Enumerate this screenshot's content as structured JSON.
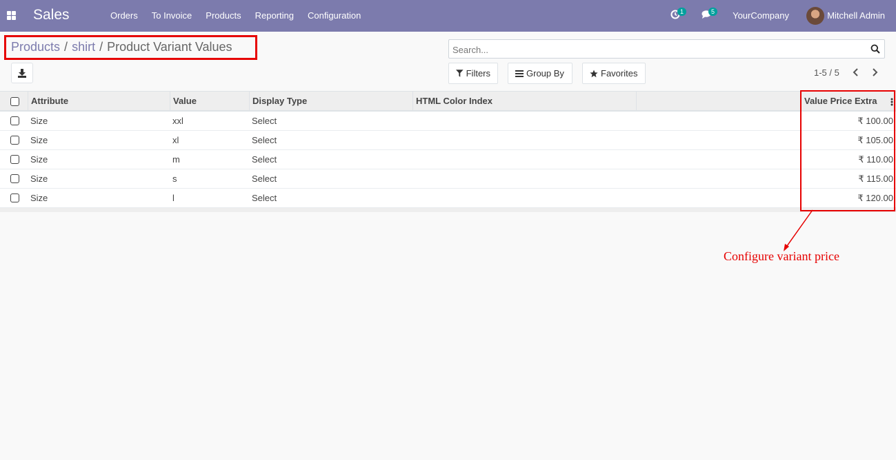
{
  "navbar": {
    "app_name": "Sales",
    "menu": [
      "Orders",
      "To Invoice",
      "Products",
      "Reporting",
      "Configuration"
    ],
    "activity_count": "1",
    "messages_count": "5",
    "company": "YourCompany",
    "user": "Mitchell Admin",
    "accent_color": "#7c7bad"
  },
  "breadcrumb": {
    "items": [
      "Products",
      "shirt",
      "Product Variant Values"
    ],
    "separator": "/"
  },
  "search": {
    "placeholder": "Search..."
  },
  "buttons": {
    "filters": "Filters",
    "group_by": "Group By",
    "favorites": "Favorites"
  },
  "pager": {
    "value": "1-5 / 5"
  },
  "table": {
    "columns": [
      "Attribute",
      "Value",
      "Display Type",
      "HTML Color Index",
      "",
      "Value Price Extra"
    ],
    "rows": [
      {
        "attribute": "Size",
        "value": "xxl",
        "display_type": "Select",
        "color_index": "",
        "price_extra": "₹ 100.00"
      },
      {
        "attribute": "Size",
        "value": "xl",
        "display_type": "Select",
        "color_index": "",
        "price_extra": "₹ 105.00"
      },
      {
        "attribute": "Size",
        "value": "m",
        "display_type": "Select",
        "color_index": "",
        "price_extra": "₹ 110.00"
      },
      {
        "attribute": "Size",
        "value": "s",
        "display_type": "Select",
        "color_index": "",
        "price_extra": "₹ 115.00"
      },
      {
        "attribute": "Size",
        "value": "l",
        "display_type": "Select",
        "color_index": "",
        "price_extra": "₹ 120.00"
      }
    ]
  },
  "annotation": {
    "text": "Configure variant price",
    "color": "#e60000"
  }
}
